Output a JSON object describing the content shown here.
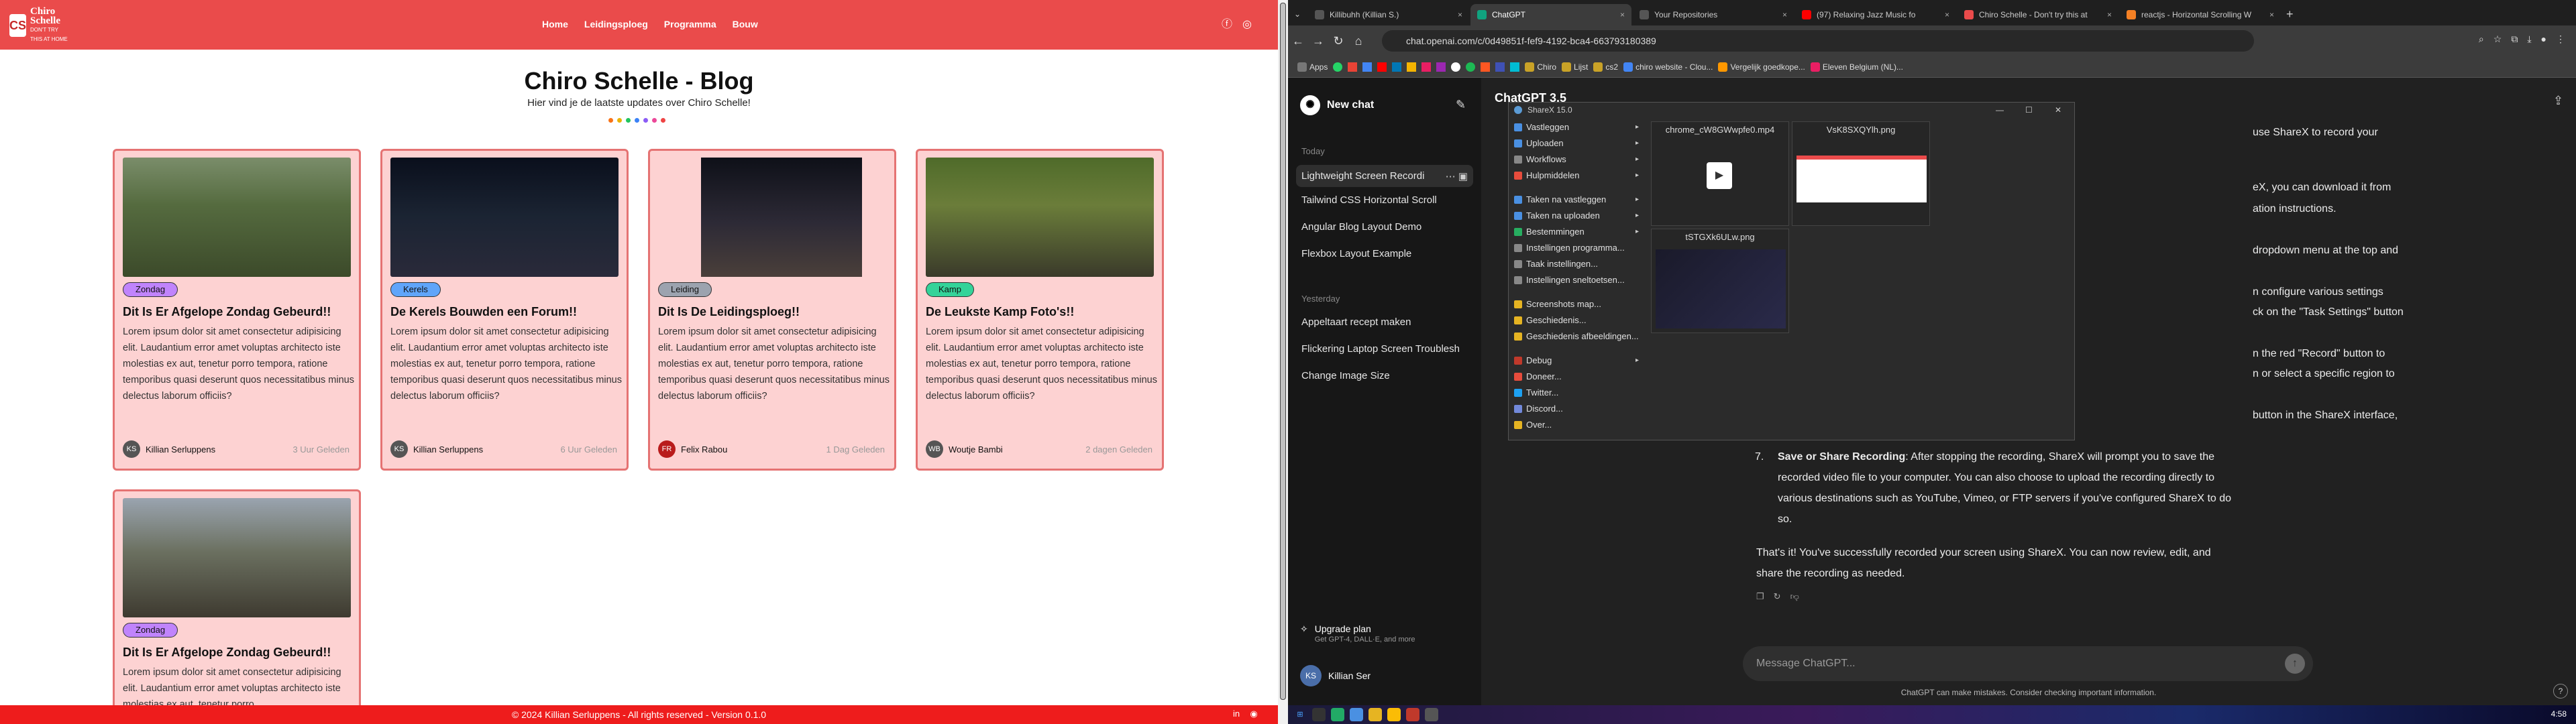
{
  "blog": {
    "logo_text": "Chiro Schelle",
    "logo_sub": "DON'T TRY THIS AT HOME",
    "nav": [
      "Home",
      "Leidingsploeg",
      "Programma",
      "Bouw"
    ],
    "title": "Chiro Schelle - Blog",
    "subtitle": "Hier vind je de laatste updates over Chiro Schelle!",
    "dot_colors": [
      "#f97316",
      "#eab308",
      "#22c55e",
      "#3b82f6",
      "#8b5cf6",
      "#ec4899",
      "#ef4444"
    ],
    "cards": [
      {
        "badge": "Zondag",
        "badge_color": "#c084fc",
        "title": "Dit Is Er Afgelope Zondag Gebeurd!!",
        "body": "Lorem ipsum dolor sit amet consectetur adipisicing elit. Laudantium error amet voluptas architecto iste molestias ex aut, tenetur porro tempora, ratione temporibus quasi deserunt quos necessitatibus minus delectus laborum officiis?",
        "author": "Killian Serluppens",
        "time": "3 Uur Geleden"
      },
      {
        "badge": "Kerels",
        "badge_color": "#60a5fa",
        "title": "De Kerels Bouwden een Forum!!",
        "body": "Lorem ipsum dolor sit amet consectetur adipisicing elit. Laudantium error amet voluptas architecto iste molestias ex aut, tenetur porro tempora, ratione temporibus quasi deserunt quos necessitatibus minus delectus laborum officiis?",
        "author": "Killian Serluppens",
        "time": "6 Uur Geleden"
      },
      {
        "badge": "Leiding",
        "badge_color": "#9ca3af",
        "title": "Dit Is De Leidingsploeg!!",
        "body": "Lorem ipsum dolor sit amet consectetur adipisicing elit. Laudantium error amet voluptas architecto iste molestias ex aut, tenetur porro tempora, ratione temporibus quasi deserunt quos necessitatibus minus delectus laborum officiis?",
        "author": "Felix Rabou",
        "time": "1 Dag Geleden"
      },
      {
        "badge": "Kamp",
        "badge_color": "#34d399",
        "title": "De Leukste Kamp Foto's!!",
        "body": "Lorem ipsum dolor sit amet consectetur adipisicing elit. Laudantium error amet voluptas architecto iste molestias ex aut, tenetur porro tempora, ratione temporibus quasi deserunt quos necessitatibus minus delectus laborum officiis?",
        "author": "Woutje Bambi",
        "time": "2 dagen Geleden"
      },
      {
        "badge": "Zondag",
        "badge_color": "#c084fc",
        "title": "Dit Is Er Afgelope Zondag Gebeurd!!",
        "body": "Lorem ipsum dolor sit amet consectetur adipisicing elit. Laudantium error amet voluptas architecto iste molestias ex aut, tenetur porro",
        "author": "",
        "time": ""
      }
    ],
    "footer": "© 2024 Killian Serluppens - All rights reserved - Version 0.1.0"
  },
  "browser": {
    "tabs": [
      "Killibuhh (Killian S.)",
      "ChatGPT",
      "Your Repositories",
      "(97) Relaxing Jazz Music fo",
      "Chiro Schelle - Don't try this at",
      "reactjs - Horizontal Scrolling W"
    ],
    "url": "chat.openai.com/c/0d49851f-fef9-4192-bca4-663793180389",
    "bookmarks": [
      "Apps",
      "Chiro",
      "Lijst",
      "cs2",
      "chiro website - Clou...",
      "Vergelijk goedkope...",
      "Eleven Belgium (NL)..."
    ]
  },
  "chat": {
    "new_chat": "New chat",
    "today": "Today",
    "yesterday": "Yesterday",
    "history_today": [
      "Lightweight Screen Recordi",
      "Tailwind CSS Horizontal Scroll",
      "Angular Blog Layout Demo",
      "Flexbox Layout Example"
    ],
    "history_yesterday": [
      "Appeltaart recept maken",
      "Flickering Laptop Screen Troublesh",
      "Change Image Size"
    ],
    "upgrade": "Upgrade plan",
    "upgrade_sub": "Get GPT-4, DALL·E, and more",
    "user": "Killian Ser",
    "title": "ChatGPT 3.5",
    "lines": [
      "use ShareX to record your",
      "",
      "eX, you can download it from",
      "ation instructions.",
      "",
      "dropdown menu at the top and",
      "",
      "n configure various settings",
      "ck on the \"Task Settings\" button",
      "",
      "n the red \"Record\" button to",
      "n or select a specific region to",
      "",
      "button in the ShareX interface,"
    ],
    "step7_num": "7.",
    "step7_bold": "Save or Share Recording",
    "step7_text": ": After stopping the recording, ShareX will prompt you to save the",
    "step7_l2": "recorded video file to your computer. You can also choose to upload the recording directly to",
    "step7_l3": "various destinations such as YouTube, Vimeo, or FTP servers if you've configured ShareX to do",
    "step7_l4": "so.",
    "outro1": "That's it! You've successfully recorded your screen using ShareX. You can now review, edit, and",
    "outro2": "share the recording as needed.",
    "input_placeholder": "Message ChatGPT...",
    "disclaimer": "ChatGPT can make mistakes. Consider checking important information.",
    "clock": "4:58"
  },
  "sharex": {
    "title": "ShareX 15.0",
    "menu": [
      "Vastleggen",
      "Uploaden",
      "Workflows",
      "Hulpmiddelen",
      "Taken na vastleggen",
      "Taken na uploaden",
      "Bestemmingen",
      "Instellingen programma...",
      "Taak instellingen...",
      "Instellingen sneltoetsen...",
      "Screenshots map...",
      "Geschiedenis...",
      "Geschiedenis afbeeldingen...",
      "Debug",
      "Doneer...",
      "Twitter...",
      "Discord...",
      "Over..."
    ],
    "files": [
      "chrome_cW8GWwpfe0.mp4",
      "VsK8SXQYlh.png",
      "tSTGXk6ULw.png"
    ]
  }
}
